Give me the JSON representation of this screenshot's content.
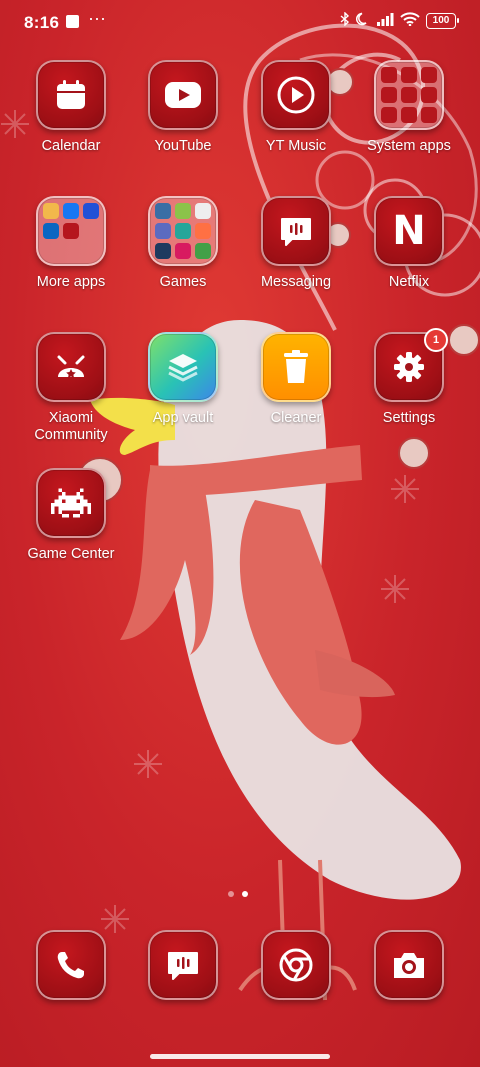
{
  "status_bar": {
    "time": "8:16",
    "battery": "100",
    "icons": [
      "bluetooth-icon",
      "moon-icon",
      "signal-icon",
      "wifi-icon",
      "battery-icon"
    ]
  },
  "apps": [
    {
      "label": "Calendar",
      "icon": "calendar-icon"
    },
    {
      "label": "YouTube",
      "icon": "youtube-icon"
    },
    {
      "label": "YT Music",
      "icon": "yt-music-icon"
    },
    {
      "label": "System apps",
      "icon": "system-apps-folder"
    },
    {
      "label": "More apps",
      "icon": "more-apps-folder"
    },
    {
      "label": "Games",
      "icon": "games-folder"
    },
    {
      "label": "Messaging",
      "icon": "messaging-icon"
    },
    {
      "label": "Netflix",
      "icon": "netflix-icon"
    },
    {
      "label": "Xiaomi\nCommunity",
      "icon": "xiaomi-community-icon"
    },
    {
      "label": "App vault",
      "icon": "app-vault-icon"
    },
    {
      "label": "Cleaner",
      "icon": "cleaner-icon"
    },
    {
      "label": "Settings",
      "icon": "settings-icon",
      "badge": "1"
    },
    {
      "label": "Game Center",
      "icon": "game-center-icon"
    }
  ],
  "dock": [
    {
      "icon": "phone-icon"
    },
    {
      "icon": "messaging-icon"
    },
    {
      "icon": "chrome-icon"
    },
    {
      "icon": "camera-icon"
    }
  ],
  "pager": {
    "pages": 2,
    "active": 2
  },
  "colors": {
    "accent": "#c4171e",
    "wallpaper": "#d32a2f"
  }
}
